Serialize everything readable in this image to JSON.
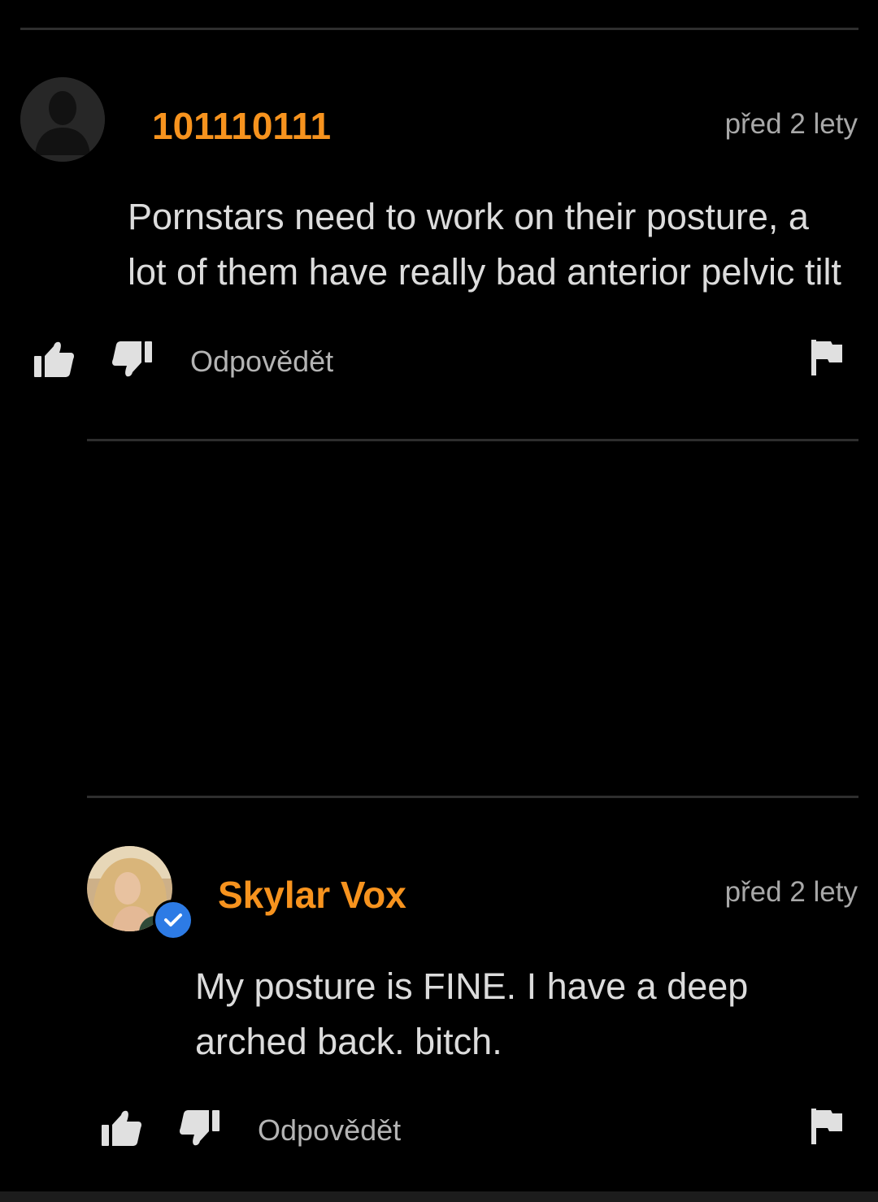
{
  "comments": [
    {
      "username": "101110111",
      "timestamp": "před 2 lety",
      "lines": [
        "Pornstars need to work on their posture, a",
        "lot of them have really bad anterior pelvic tilt"
      ],
      "reply_label": "Odpovědět",
      "avatar": "default-user-silhouette",
      "verified": false
    },
    {
      "username": "Skylar Vox",
      "timestamp": "před 2 lety",
      "lines": [
        "My posture is FINE. I have a deep",
        "arched back. bitch."
      ],
      "reply_label": "Odpovědět",
      "avatar": "user-photo",
      "verified": true
    }
  ],
  "icons": {
    "like": "thumbs-up-icon",
    "dislike": "thumbs-down-icon",
    "flag": "flag-icon",
    "verified": "check-icon"
  },
  "colors": {
    "background": "#000000",
    "username": "#f7931e",
    "verified": "#2d7be5"
  }
}
